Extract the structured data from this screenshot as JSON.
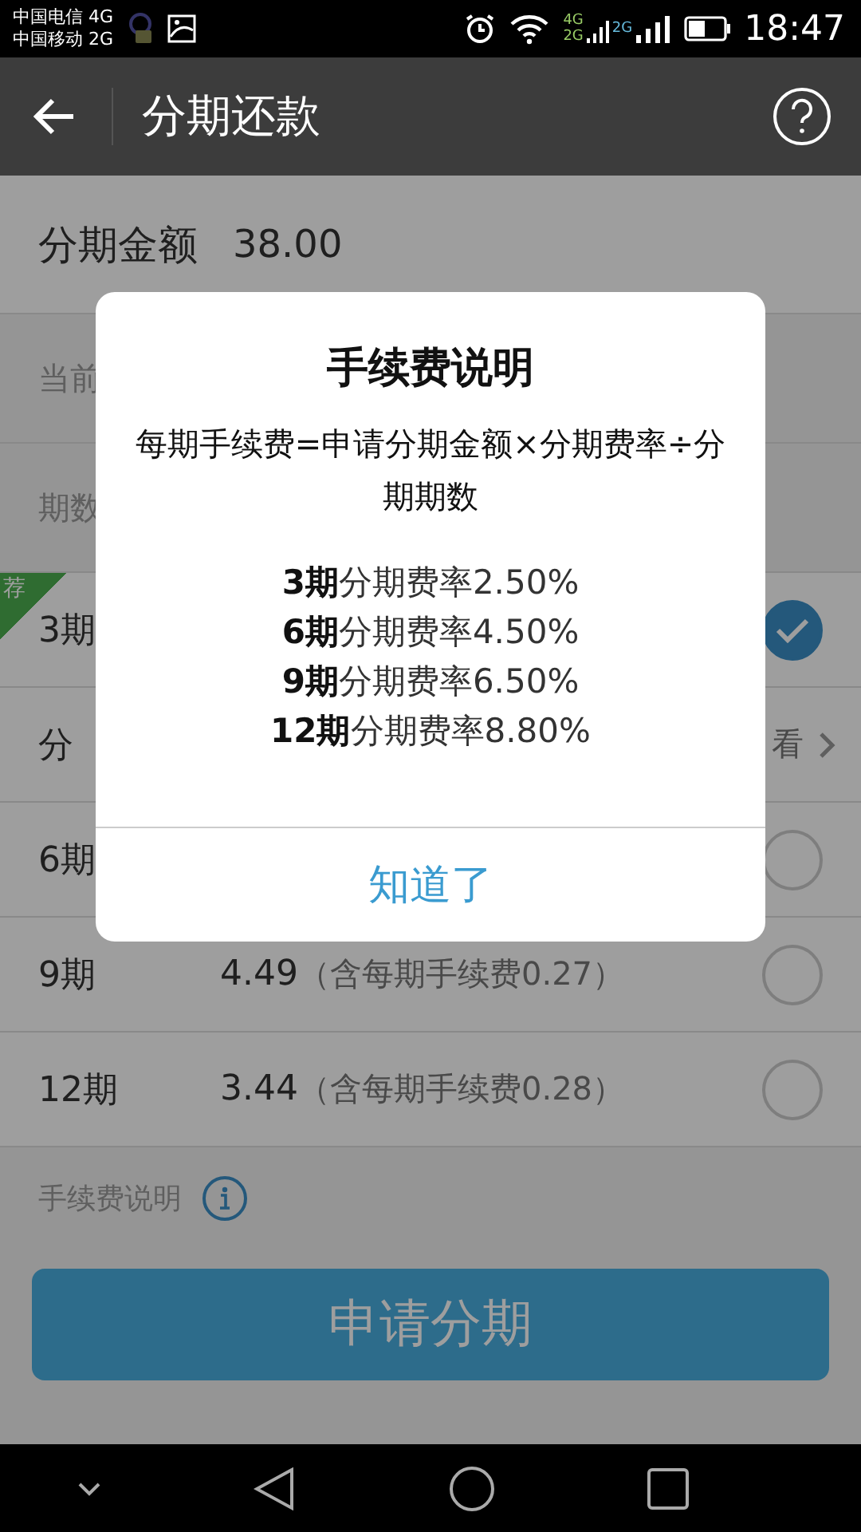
{
  "status_bar": {
    "carriers": [
      "中国电信 4G",
      "中国移动 2G"
    ],
    "signal_labels": [
      "4G",
      "2G",
      "2G"
    ],
    "time": "18:47"
  },
  "app_bar": {
    "title": "分期还款"
  },
  "amount": {
    "label": "分期金额",
    "value": "38.00"
  },
  "current": {
    "label": "当前"
  },
  "periods_header": {
    "label": "期数"
  },
  "rows": [
    {
      "kind": "option",
      "label": "3期",
      "badge": "荐",
      "selected": true
    },
    {
      "kind": "link",
      "label": "分",
      "trailing": "看"
    },
    {
      "kind": "option",
      "label": "6期",
      "selected": false
    },
    {
      "kind": "option",
      "label": "9期",
      "amount": "4.49",
      "fee": "（含每期手续费0.27）",
      "selected": false
    },
    {
      "kind": "option",
      "label": "12期",
      "amount": "3.44",
      "fee": "（含每期手续费0.28）",
      "selected": false
    }
  ],
  "fee_info": {
    "label": "手续费说明"
  },
  "apply_button": {
    "label": "申请分期"
  },
  "dialog": {
    "title": "手续费说明",
    "formula": "每期手续费=申请分期金额×分期费率÷分期期数",
    "rates": [
      "**3期**分期费率2.50%",
      "**6期**分期费率4.50%",
      "**9期**分期费率6.50%",
      "**12期**分期费率8.80%"
    ],
    "button": "知道了"
  }
}
